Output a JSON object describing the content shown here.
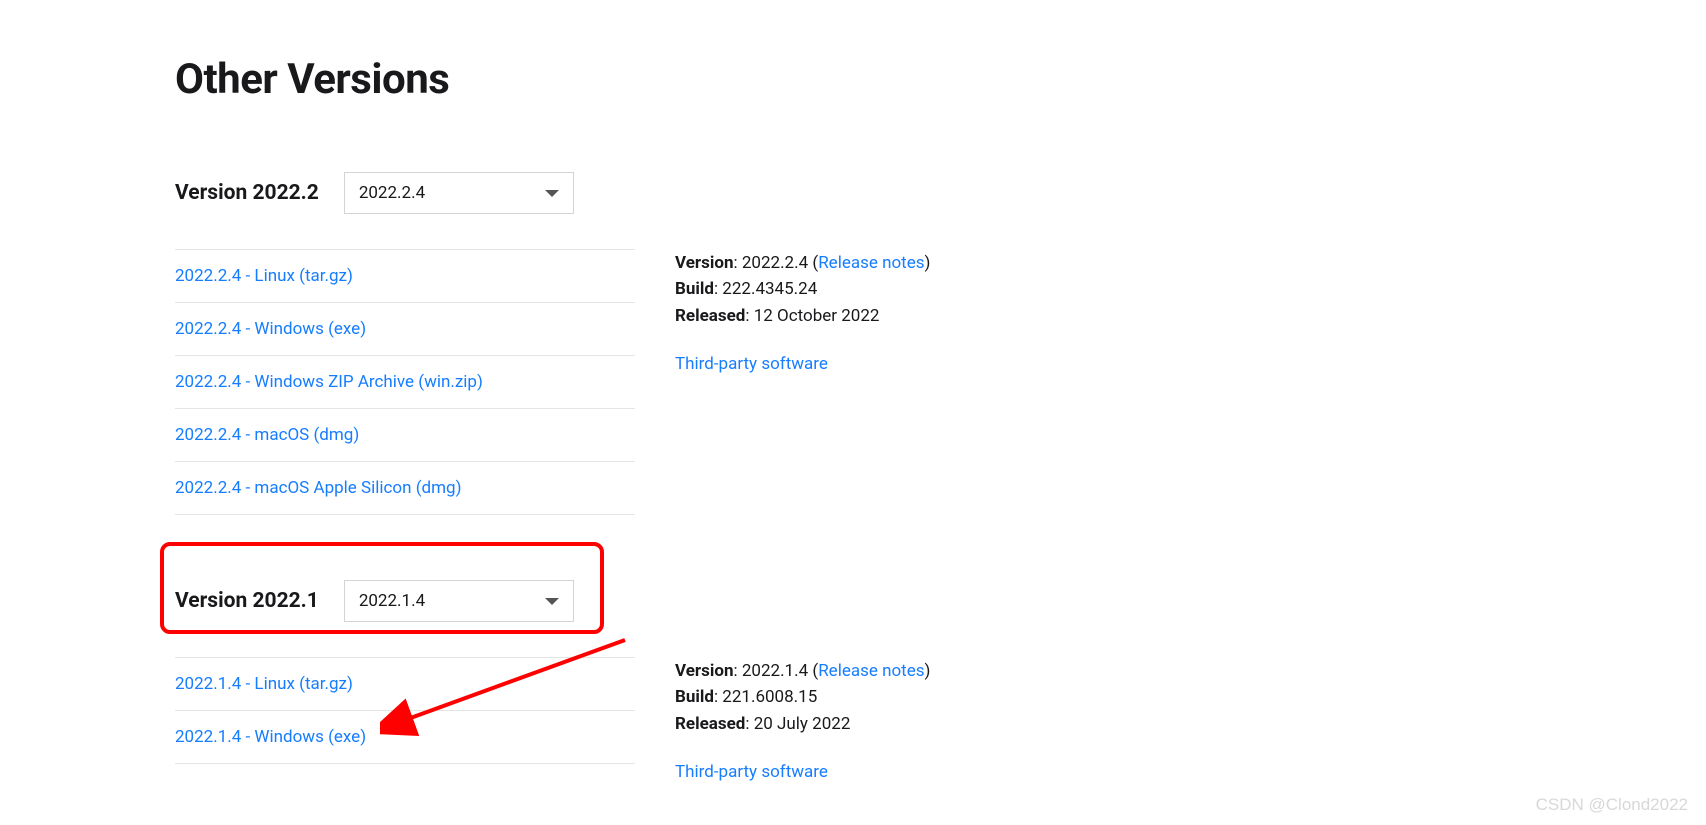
{
  "page_title": "Other Versions",
  "sections": [
    {
      "label": "Version 2022.2",
      "dropdown_value": "2022.2.4",
      "downloads": [
        "2022.2.4 - Linux (tar.gz)",
        "2022.2.4 - Windows (exe)",
        "2022.2.4 - Windows ZIP Archive (win.zip)",
        "2022.2.4 - macOS (dmg)",
        "2022.2.4 - macOS Apple Silicon (dmg)"
      ],
      "meta": {
        "version_label": "Version",
        "version_value": "2022.2.4",
        "release_notes_label": "Release notes",
        "build_label": "Build",
        "build_value": "222.4345.24",
        "released_label": "Released",
        "released_value": "12 October 2022",
        "third_party_label": "Third-party software"
      }
    },
    {
      "label": "Version 2022.1",
      "dropdown_value": "2022.1.4",
      "downloads": [
        "2022.1.4 - Linux (tar.gz)",
        "2022.1.4 - Windows (exe)"
      ],
      "meta": {
        "version_label": "Version",
        "version_value": "2022.1.4",
        "release_notes_label": "Release notes",
        "build_label": "Build",
        "build_value": "221.6008.15",
        "released_label": "Released",
        "released_value": "20 July 2022",
        "third_party_label": "Third-party software"
      }
    }
  ],
  "watermark": "CSDN @Clond2022"
}
